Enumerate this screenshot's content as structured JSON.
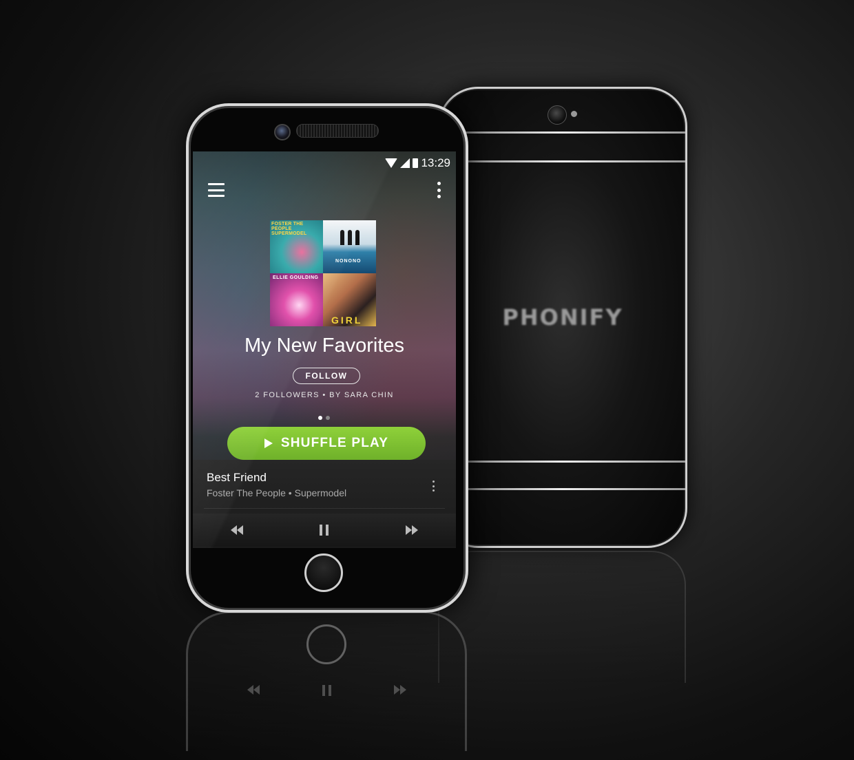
{
  "status_bar": {
    "time": "13:29"
  },
  "playlist": {
    "title": "My New Favorites",
    "follow_label": "FOLLOW",
    "meta": "2 FOLLOWERS • BY SARA CHIN",
    "shuffle_label": "SHUFFLE PLAY",
    "album_art": [
      {
        "text": "FOSTER THE PEOPLE SUPERMODEL"
      },
      {
        "text": "NONONO"
      },
      {
        "text": "ELLIE GOULDING"
      },
      {
        "text": "GIRL"
      }
    ]
  },
  "now_playing": {
    "track": "Best Friend",
    "artist_album": "Foster The People • Supermodel"
  },
  "back_phone": {
    "brand": "PHONIFY"
  },
  "colors": {
    "accent_green": "#7cc033"
  },
  "icons": [
    "menu-icon",
    "more-vert-icon",
    "wifi-icon",
    "signal-icon",
    "battery-icon",
    "play-icon",
    "rewind-icon",
    "pause-icon",
    "fast-forward-icon"
  ]
}
